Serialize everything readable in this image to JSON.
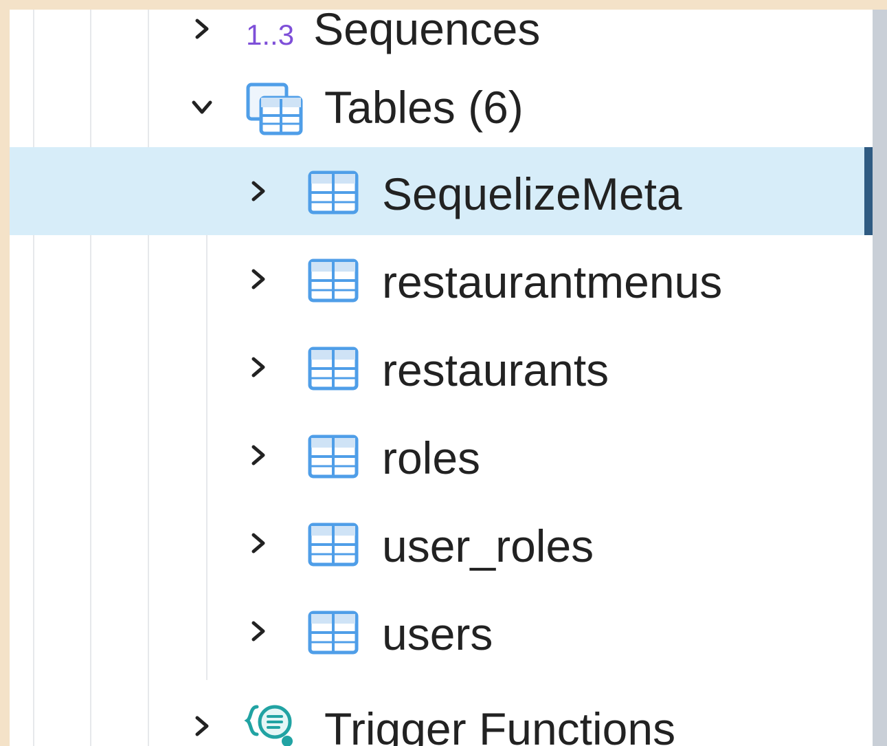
{
  "tree": {
    "sequences": {
      "icon": "sequence-icon",
      "glyph": "1..3",
      "label": "Sequences",
      "state": "collapsed"
    },
    "tables": {
      "icon": "tables-group-icon",
      "label": "Tables (6)",
      "state": "expanded",
      "items": [
        {
          "label": "SequelizeMeta",
          "icon": "table-icon",
          "selected": true
        },
        {
          "label": "restaurantmenus",
          "icon": "table-icon",
          "selected": false
        },
        {
          "label": "restaurants",
          "icon": "table-icon",
          "selected": false
        },
        {
          "label": "roles",
          "icon": "table-icon",
          "selected": false
        },
        {
          "label": "user_roles",
          "icon": "table-icon",
          "selected": false
        },
        {
          "label": "users",
          "icon": "table-icon",
          "selected": false
        }
      ]
    },
    "trigger_functions": {
      "icon": "trigger-function-icon",
      "label": "Trigger Functions",
      "state": "collapsed"
    }
  },
  "colors": {
    "selection_bg": "#d7edf9",
    "selection_bar": "#2f5b82",
    "table_icon": "#4f9ee8",
    "sequence_glyph": "#7e4fd8",
    "trigger_icon": "#21a3a3"
  }
}
